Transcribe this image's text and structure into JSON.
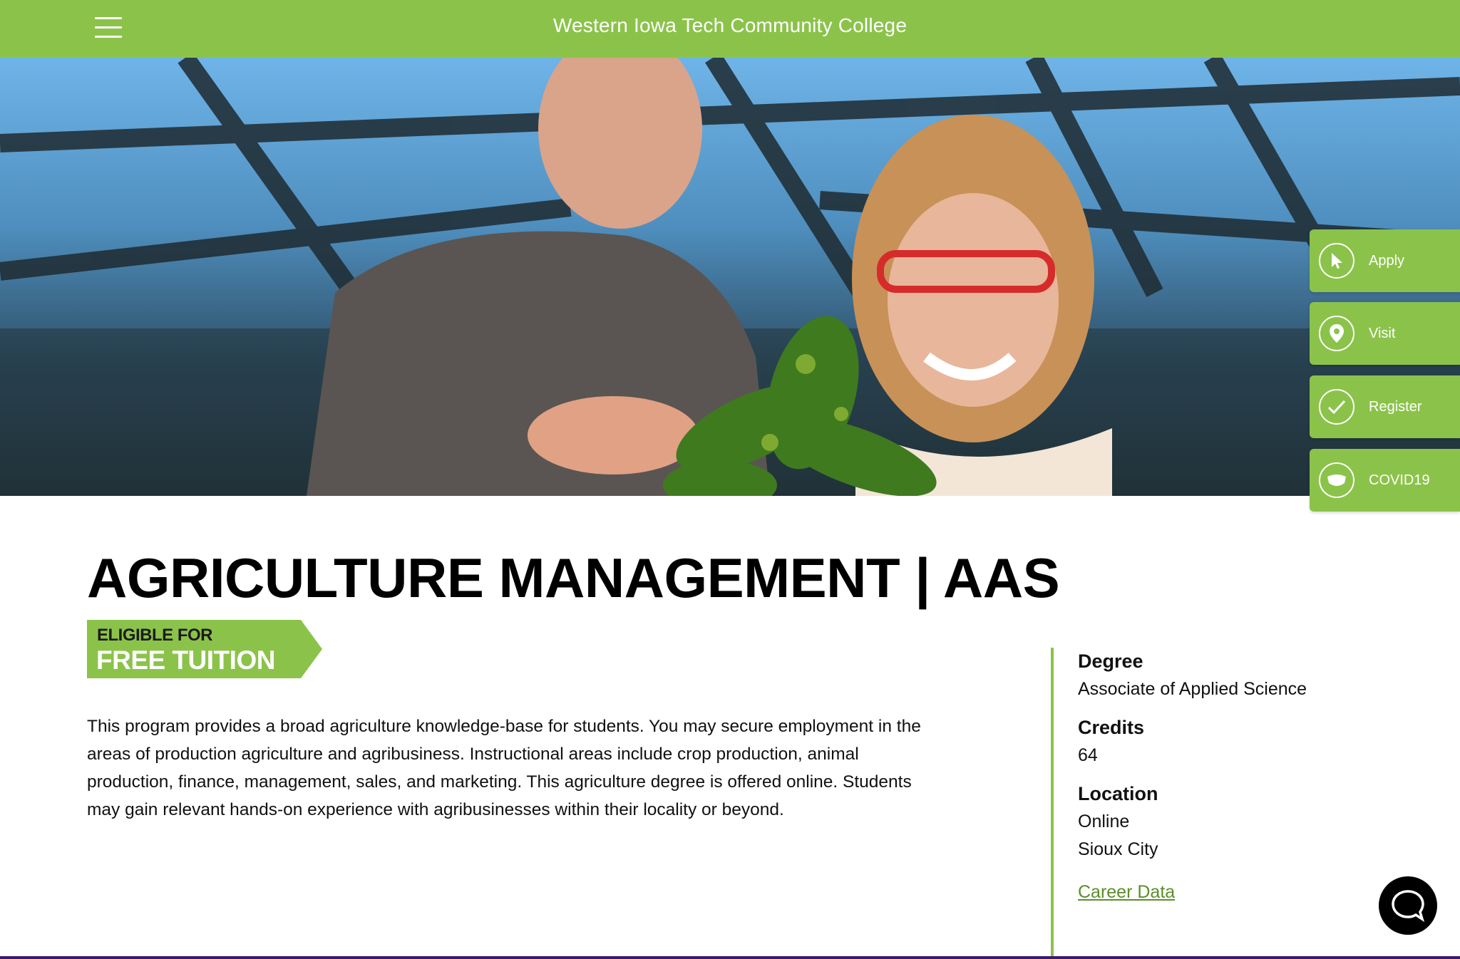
{
  "header": {
    "title": "Western Iowa Tech Community College",
    "menu_icon": "hamburger-menu-icon",
    "bg_color": "#8bc34a"
  },
  "quick_actions": [
    {
      "label": "Apply",
      "icon": "cursor-pointer-icon"
    },
    {
      "label": "Visit",
      "icon": "map-pin-icon"
    },
    {
      "label": "Register",
      "icon": "checkmark-icon"
    },
    {
      "label": "COVID19",
      "icon": "face-mask-icon"
    }
  ],
  "program": {
    "title": "AGRICULTURE MANAGEMENT | AAS",
    "badge": {
      "line1": "ELIGIBLE FOR",
      "line2": "FREE TUITION"
    },
    "description": "This program provides a broad agriculture knowledge-base for students. You may secure employment in the areas of production agriculture and agribusiness. Instructional areas include crop production, animal production, finance, management, sales, and marketing. This agriculture degree is offered online. Students may gain relevant hands-on experience with agribusinesses within their locality or beyond."
  },
  "facts": {
    "degree_label": "Degree",
    "degree_value": "Associate of Applied Science",
    "credits_label": "Credits",
    "credits_value": "64",
    "location_label": "Location",
    "locations": [
      "Online",
      "Sioux City"
    ],
    "career_link": "Career Data"
  },
  "chat": {
    "icon": "chat-bubble-icon"
  },
  "colors": {
    "accent": "#8bc34a",
    "link": "#5a8f2a",
    "footer": "#3a1a6e"
  }
}
